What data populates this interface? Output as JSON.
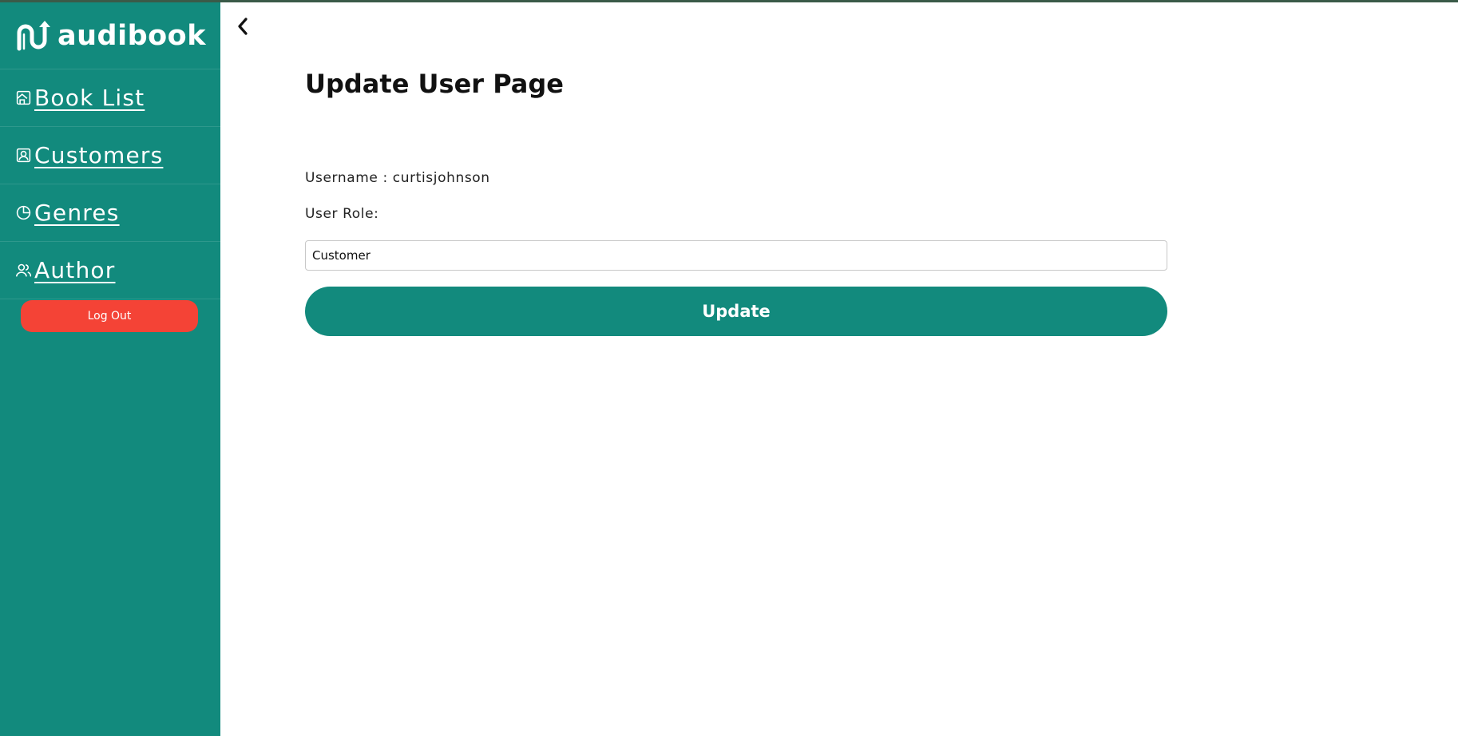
{
  "app": {
    "brand_name": "audibook",
    "logo_icon": "audibook-logo",
    "accent_color": "#128a7d",
    "danger_color": "#f44336"
  },
  "sidebar": {
    "items": [
      {
        "label": "Book List",
        "icon": "house-icon"
      },
      {
        "label": "Customers",
        "icon": "contact-card-icon"
      },
      {
        "label": "Genres",
        "icon": "pie-chart-icon"
      },
      {
        "label": "Author",
        "icon": "users-icon"
      }
    ],
    "logout_label": "Log Out"
  },
  "header": {
    "back_icon": "chevron-left-icon"
  },
  "main": {
    "title": "Update User Page",
    "username_text": "Username : curtisjohnson",
    "role_label": "User Role:",
    "role_value": "Customer",
    "update_label": "Update"
  }
}
